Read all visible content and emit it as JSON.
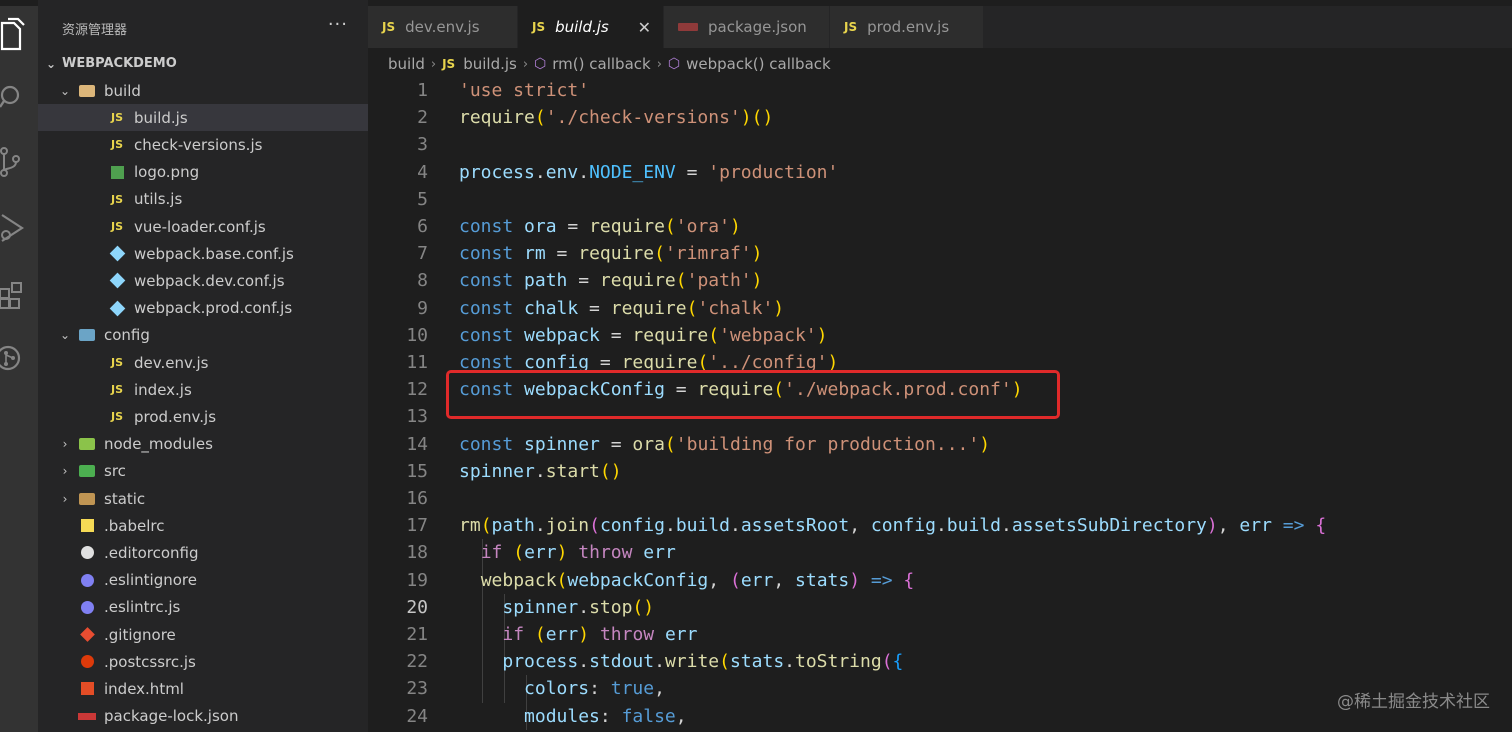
{
  "explorer": {
    "title": "资源管理器",
    "more": "···",
    "root": "WEBPACKDEMO",
    "items": [
      {
        "label": "build",
        "kind": "folder-open",
        "icon": "folder-icon",
        "depth": 1
      },
      {
        "label": "build.js",
        "kind": "js",
        "icon": "js-file-icon",
        "depth": 2,
        "selected": true
      },
      {
        "label": "check-versions.js",
        "kind": "js",
        "icon": "js-file-icon",
        "depth": 2
      },
      {
        "label": "logo.png",
        "kind": "image",
        "icon": "image-file-icon",
        "depth": 2
      },
      {
        "label": "utils.js",
        "kind": "js",
        "icon": "js-file-icon",
        "depth": 2
      },
      {
        "label": "vue-loader.conf.js",
        "kind": "js",
        "icon": "js-file-icon",
        "depth": 2
      },
      {
        "label": "webpack.base.conf.js",
        "kind": "webpack",
        "icon": "webpack-file-icon",
        "depth": 2
      },
      {
        "label": "webpack.dev.conf.js",
        "kind": "webpack",
        "icon": "webpack-file-icon",
        "depth": 2
      },
      {
        "label": "webpack.prod.conf.js",
        "kind": "webpack",
        "icon": "webpack-file-icon",
        "depth": 2
      },
      {
        "label": "config",
        "kind": "folder-open",
        "icon": "config-folder-icon",
        "depth": 1
      },
      {
        "label": "dev.env.js",
        "kind": "js",
        "icon": "js-file-icon",
        "depth": 2
      },
      {
        "label": "index.js",
        "kind": "js",
        "icon": "js-file-icon",
        "depth": 2
      },
      {
        "label": "prod.env.js",
        "kind": "js",
        "icon": "js-file-icon",
        "depth": 2
      },
      {
        "label": "node_modules",
        "kind": "folder",
        "icon": "node-folder-icon",
        "depth": 1
      },
      {
        "label": "src",
        "kind": "folder",
        "icon": "src-folder-icon",
        "depth": 1
      },
      {
        "label": "static",
        "kind": "folder",
        "icon": "folder-icon",
        "depth": 1
      },
      {
        "label": ".babelrc",
        "kind": "babel",
        "icon": "babel-file-icon",
        "depth": 1
      },
      {
        "label": ".editorconfig",
        "kind": "editorconfig",
        "icon": "editorconfig-file-icon",
        "depth": 1
      },
      {
        "label": ".eslintignore",
        "kind": "eslint",
        "icon": "eslint-file-icon",
        "depth": 1
      },
      {
        "label": ".eslintrc.js",
        "kind": "eslint",
        "icon": "eslint-file-icon",
        "depth": 1
      },
      {
        "label": ".gitignore",
        "kind": "git",
        "icon": "git-file-icon",
        "depth": 1
      },
      {
        "label": ".postcssrc.js",
        "kind": "postcss",
        "icon": "postcss-file-icon",
        "depth": 1
      },
      {
        "label": "index.html",
        "kind": "html",
        "icon": "html-file-icon",
        "depth": 1
      },
      {
        "label": "package-lock.json",
        "kind": "npm",
        "icon": "npm-file-icon",
        "depth": 1
      }
    ]
  },
  "activity_bar": [
    "explorer-icon",
    "search-icon",
    "source-control-icon",
    "run-debug-icon",
    "extensions-icon",
    "git-graph-icon"
  ],
  "tabs": [
    {
      "label": "dev.env.js",
      "kind": "js"
    },
    {
      "label": "build.js",
      "kind": "js",
      "active": true,
      "close": "✕"
    },
    {
      "label": "package.json",
      "kind": "npm"
    },
    {
      "label": "prod.env.js",
      "kind": "js"
    }
  ],
  "js_badge": "JS",
  "breadcrumb": [
    "build",
    "build.js",
    "rm() callback",
    "webpack() callback"
  ],
  "code_lines": [
    "'use strict'",
    "require('./check-versions')()",
    "",
    "process.env.NODE_ENV = 'production'",
    "",
    "const ora = require('ora')",
    "const rm = require('rimraf')",
    "const path = require('path')",
    "const chalk = require('chalk')",
    "const webpack = require('webpack')",
    "const config = require('../config')",
    "const webpackConfig = require('./webpack.prod.conf')",
    "",
    "const spinner = ora('building for production...')",
    "spinner.start()",
    "",
    "rm(path.join(config.build.assetsRoot, config.build.assetsSubDirectory), err => {",
    "  if (err) throw err",
    "  webpack(webpackConfig, (err, stats) => {",
    "    spinner.stop()",
    "    if (err) throw err",
    "    process.stdout.write(stats.toString({",
    "      colors: true,",
    "      modules: false,"
  ],
  "current_line": 20,
  "highlighted_line": 12,
  "watermark": "@稀土掘金技术社区"
}
